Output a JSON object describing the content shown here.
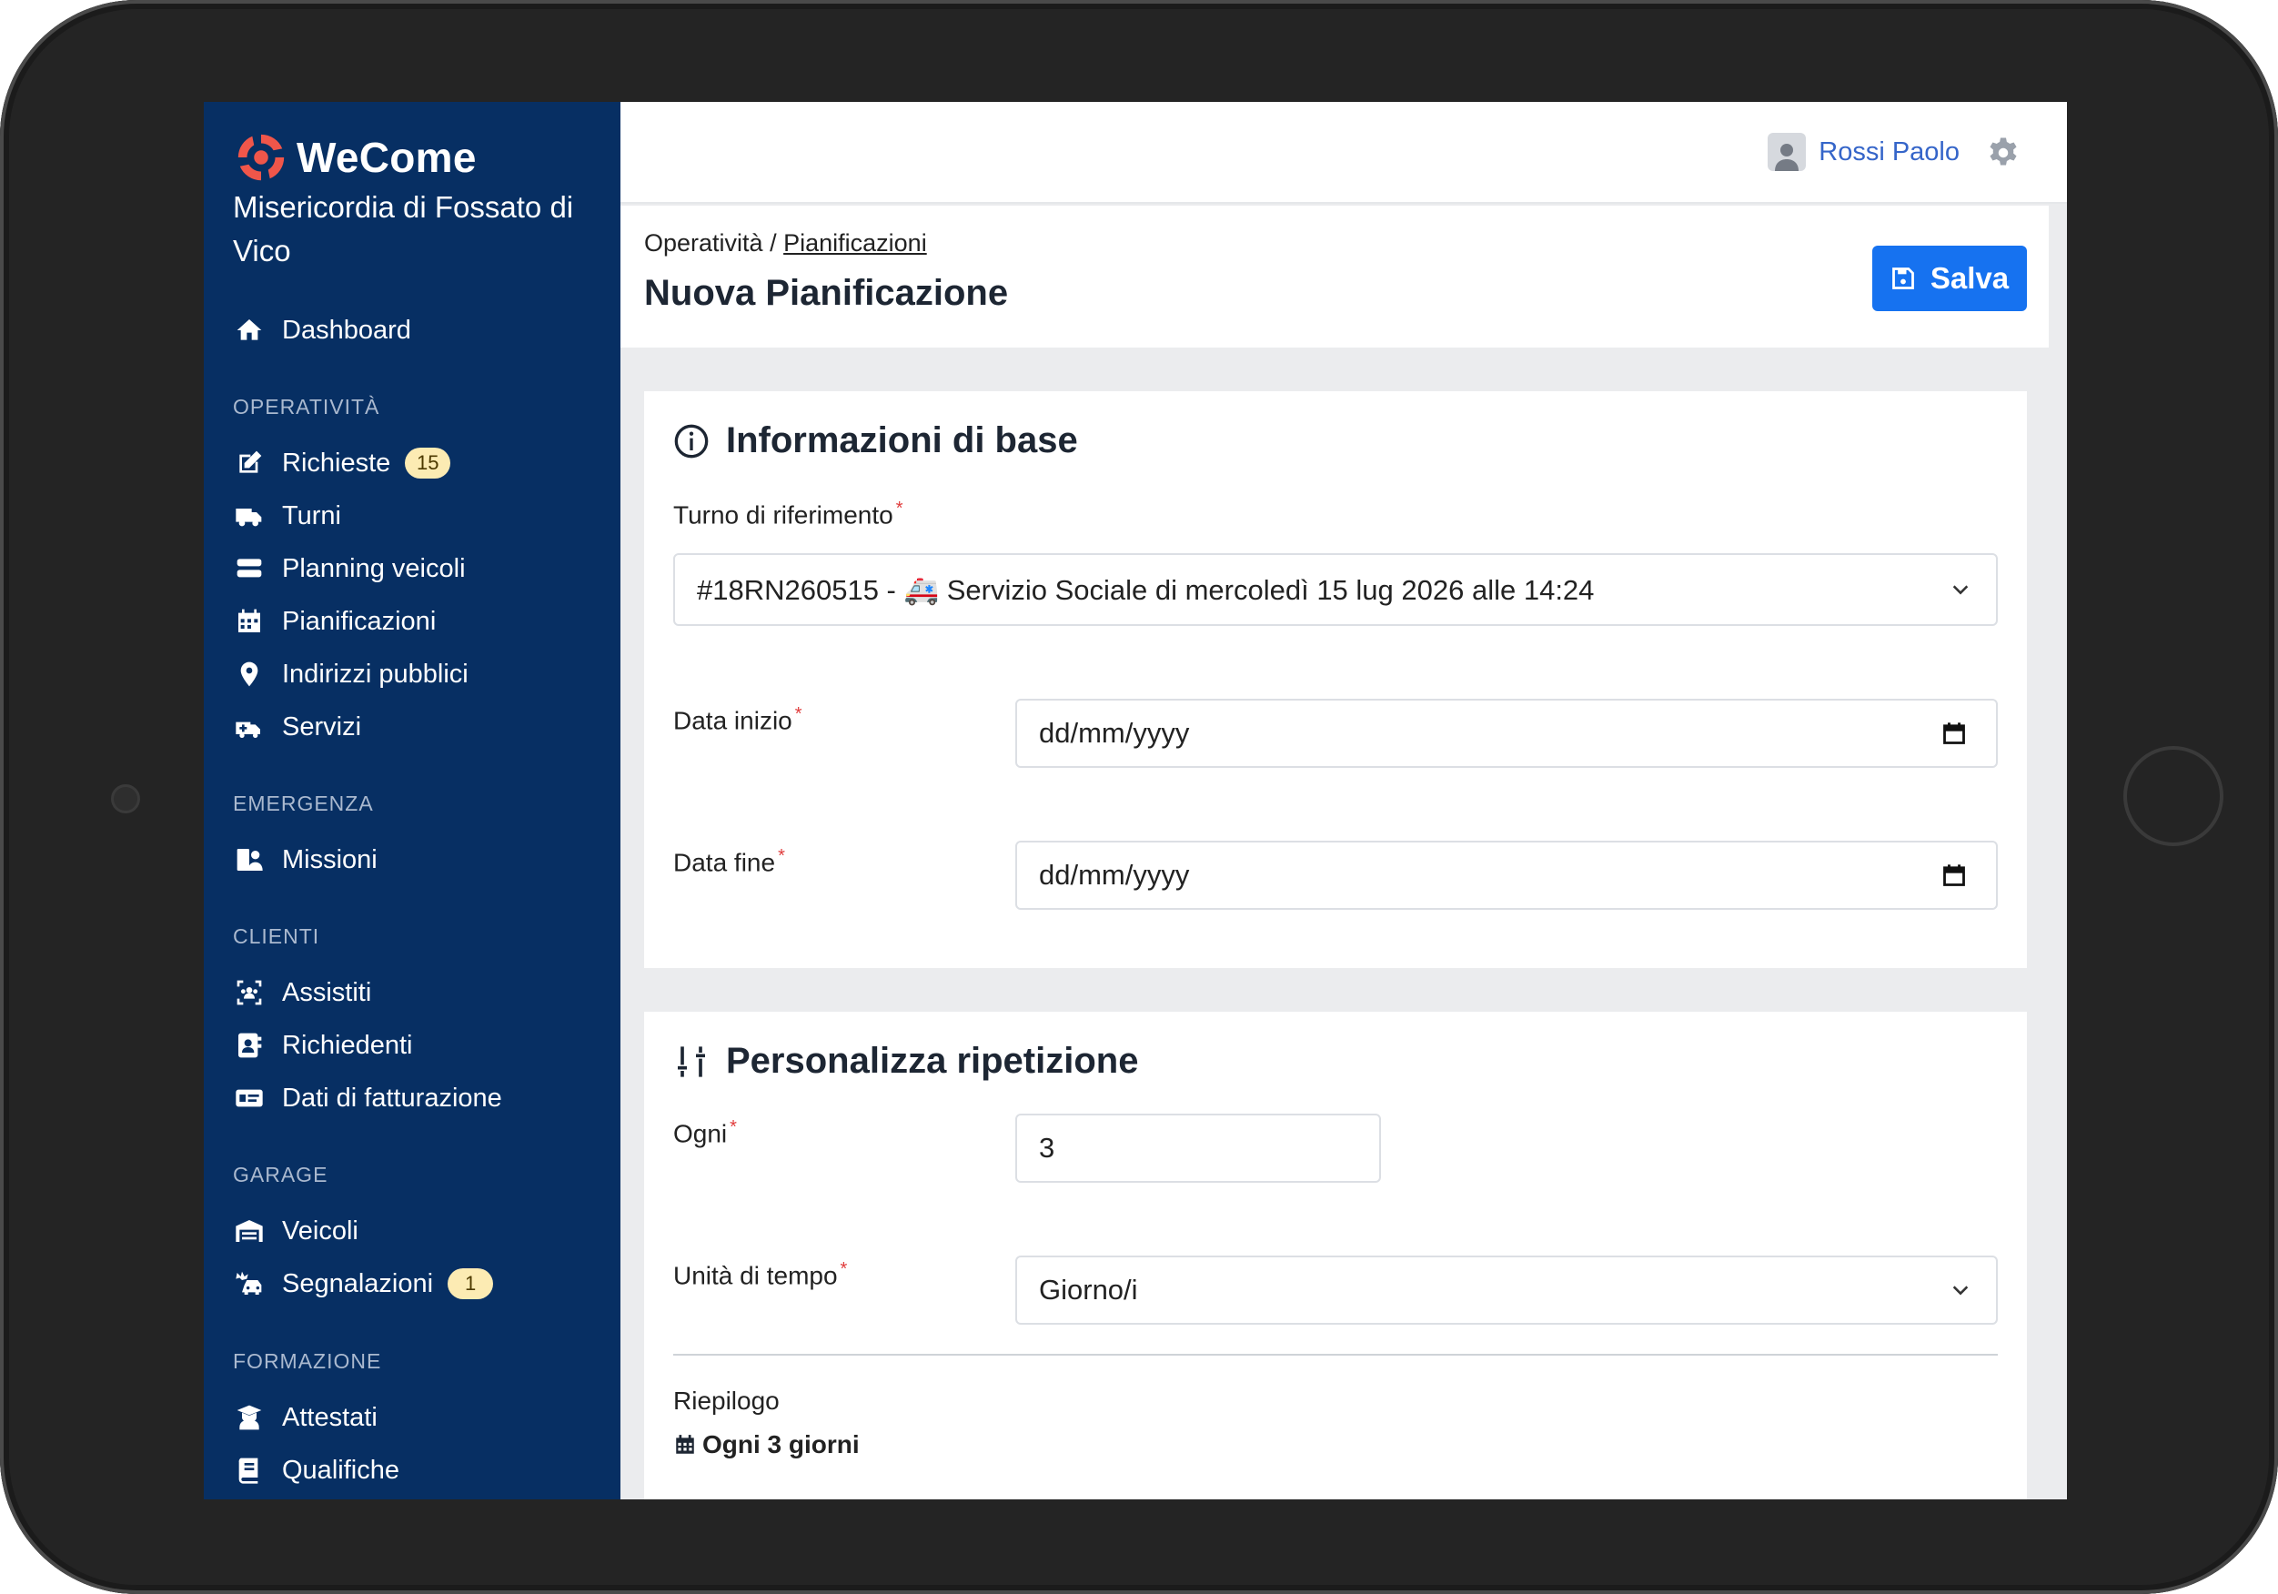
{
  "brand": {
    "name": "WeCome",
    "organization": "Misericordia di Fossato di Vico"
  },
  "sidebar": {
    "dashboard": "Dashboard",
    "sections": {
      "operativita": "OPERATIVITÀ",
      "emergenza": "EMERGENZA",
      "clienti": "CLIENTI",
      "garage": "GARAGE",
      "formazione": "FORMAZIONE"
    },
    "items": {
      "richieste": "Richieste",
      "richieste_badge": "15",
      "turni": "Turni",
      "planning_veicoli": "Planning veicoli",
      "pianificazioni": "Pianificazioni",
      "indirizzi_pubblici": "Indirizzi pubblici",
      "servizi": "Servizi",
      "missioni": "Missioni",
      "assistiti": "Assistiti",
      "richiedenti": "Richiedenti",
      "dati_fatturazione": "Dati di fatturazione",
      "veicoli": "Veicoli",
      "segnalazioni": "Segnalazioni",
      "segnalazioni_badge": "1",
      "attestati": "Attestati",
      "qualifiche": "Qualifiche"
    }
  },
  "topbar": {
    "user_name": "Rossi Paolo"
  },
  "header": {
    "breadcrumb_root": "Operatività",
    "breadcrumb_sep": "/",
    "breadcrumb_link": "Pianificazioni",
    "title": "Nuova Pianificazione",
    "save_label": "Salva"
  },
  "base_info": {
    "title": "Informazioni di base",
    "turno_label": "Turno di riferimento",
    "turno_value": "#18RN260515 - 🚑 Servizio Sociale di mercoledì 15 lug 2026 alle 14:24",
    "data_inizio_label": "Data inizio",
    "data_inizio_value": "dd/mm/yyyy",
    "data_fine_label": "Data fine",
    "data_fine_value": "dd/mm/yyyy",
    "required_mark": "*"
  },
  "repeat": {
    "title": "Personalizza ripetizione",
    "ogni_label": "Ogni",
    "ogni_value": "3",
    "unita_label": "Unità di tempo",
    "unita_value": "Giorno/i",
    "riepilogo_label": "Riepilogo",
    "riepilogo_value": "Ogni 3 giorni"
  },
  "colors": {
    "sidebar_bg": "#072f63",
    "primary": "#1672f0",
    "badge_bg": "#fcebb3",
    "user_link": "#3565c9",
    "required": "#e03c3c"
  }
}
